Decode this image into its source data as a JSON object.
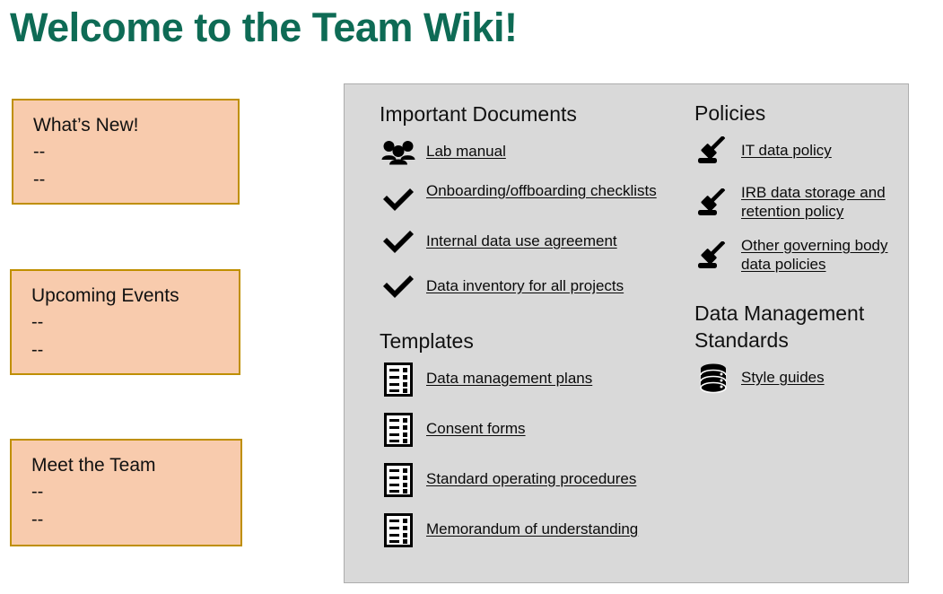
{
  "page": {
    "title": "Welcome to the Team Wiki!",
    "title_color": "#0E6B55",
    "panel_bg": "#D9D9D9",
    "box_bg": "#F8CBAD",
    "box_border": "#BF8F00"
  },
  "sidebar": {
    "boxes": [
      {
        "title": "What’s New!",
        "lines": [
          "--",
          "--"
        ]
      },
      {
        "title": "Upcoming Events",
        "lines": [
          "--",
          "--"
        ]
      },
      {
        "title": "Meet the Team",
        "lines": [
          "--",
          "--"
        ]
      }
    ]
  },
  "panel": {
    "left_column": [
      {
        "heading": "Important Documents",
        "items": [
          {
            "label": "Lab manual",
            "icon": "people-icon",
            "lines": 1
          },
          {
            "label": "Onboarding/offboarding checklists",
            "icon": "checkmark-icon",
            "lines": 2
          },
          {
            "label": "Internal data use agreement",
            "icon": "checkmark-icon",
            "lines": 1
          },
          {
            "label": "Data inventory for all projects",
            "icon": "checkmark-icon",
            "lines": 1
          }
        ]
      },
      {
        "heading": "Templates",
        "items": [
          {
            "label": "Data management plans",
            "icon": "form-document-icon",
            "lines": 1
          },
          {
            "label": "Consent forms",
            "icon": "form-document-icon",
            "lines": 1
          },
          {
            "label": "Standard operating procedures",
            "icon": "form-document-icon",
            "lines": 1
          },
          {
            "label": "Memorandum of understanding",
            "icon": "form-document-icon",
            "lines": 1
          }
        ]
      }
    ],
    "right_column": [
      {
        "heading": "Policies",
        "items": [
          {
            "label": "IT data policy",
            "icon": "gavel-icon",
            "lines": 1
          },
          {
            "label": "IRB data storage and retention policy",
            "icon": "gavel-icon",
            "lines": 2
          },
          {
            "label": "Other governing body data policies",
            "icon": "gavel-icon",
            "lines": 2
          }
        ]
      },
      {
        "heading": "Data Management Standards",
        "items": [
          {
            "label": "Style guides",
            "icon": "database-icon",
            "lines": 1
          }
        ]
      }
    ]
  }
}
